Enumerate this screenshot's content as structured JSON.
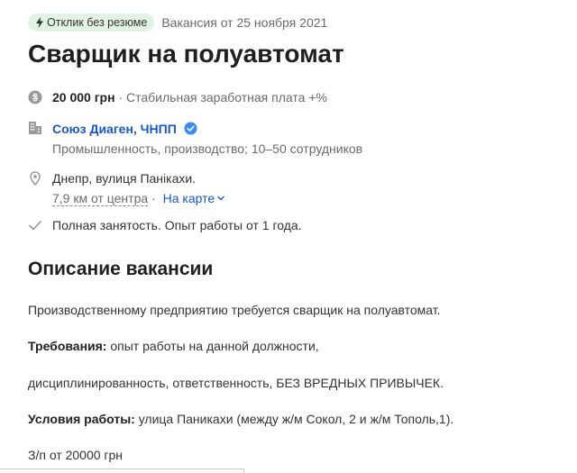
{
  "header": {
    "badge_label": "Отклик без резюме",
    "vacancy_date": "Вакансия от 25 ноября 2021"
  },
  "job": {
    "title": "Сварщик на полуавтомат",
    "salary": {
      "value": "20 000 грн",
      "separator": "·",
      "note": "Стабильная заработная плата +%"
    },
    "company": {
      "name": "Союз Диаген, ЧНПП",
      "description": "Промышленность, производство; 10–50 сотрудников"
    },
    "address": {
      "street": "Днепр, вулиця Панікахи.",
      "distance": "7,9 км от центра",
      "separator": "·",
      "map_link": "На карте"
    },
    "employment": "Полная занятость. Опыт работы от 1 года."
  },
  "description": {
    "section_title": "Описание вакансии",
    "intro": "Производственному предприятию требуется сварщик на полуавтомат.",
    "requirements_label": "Требования:",
    "requirements_text": " опыт работы на данной должности,",
    "requirements_cont": "дисциплинированность, ответственность, БЕЗ ВРЕДНЫХ ПРИВЫЧЕК.",
    "conditions_label": "Условия работы:",
    "conditions_text": " улица Паникахи (между ж/м Сокол, 2 и ж/м Тополь,1).",
    "salary_line": "З/п от 20000 грн"
  },
  "colors": {
    "link": "#1a56c5",
    "badge_bg": "#e3f3e3",
    "verified": "#3b8cf0",
    "icon_gray": "#9a9a9a"
  },
  "icons": {
    "badge": "lightning-icon",
    "salary": "hryvnia-coin-icon",
    "company": "building-icon",
    "verified": "verified-check-icon",
    "address": "location-pin-icon",
    "map_chevron": "chevron-down-icon",
    "employment": "checkmark-icon"
  }
}
